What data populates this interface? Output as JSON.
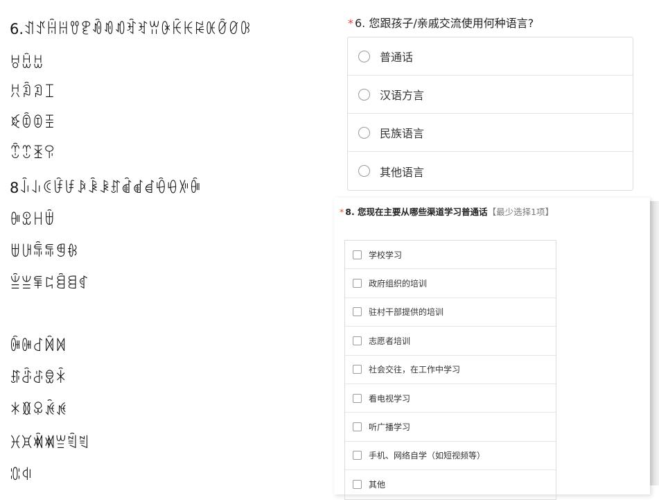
{
  "left_text": [
    "6.ꀊꀋꀌꀍꀎꀏꀐꀑꀒꀓꀔꀕꀖꀗꀘꀙꀚꀛꀜꀝ",
    "ꀞꀟꀠ",
    "ꀡꀢꀣꀤ",
    "ꀥꀦꀧꀨ",
    "ꀩꀪꀫꀬ",
    "8ꀭꀮꀯꀰꀱꀲꀳꀴꀵꀶꀷꀸꀹꀺꀻꀼ",
    "ꀽꀾꀿꁀ",
    "ꁁꁂꁃꁄꁅꁆ",
    "ꁇꁈꁉꁊꁋꁌꁍ",
    "ꁎꁏꁐꁑꁒ",
    "ꁓꁔꁕꁖꁗ",
    "ꁘꁙꁚꁛꁜ",
    "ꁝꁞꁟꁠꁡꁢꁣ",
    "ꁤꁥ"
  ],
  "q6": {
    "required_mark": "*",
    "title": "6. 您跟孩子/亲戚交流使用何种语言?",
    "options": [
      "普通话",
      "汉语方言",
      "民族语言",
      "其他语言"
    ]
  },
  "q8": {
    "required_mark": "*",
    "title": "8. 您现在主要从哪些渠道学习普通话",
    "hint": "【最少选择1项】",
    "options": [
      "学校学习",
      "政府组织的培训",
      "驻村干部提供的培训",
      "志愿者培训",
      "社会交往，在工作中学习",
      "看电视学习",
      "听广播学习",
      "手机、网络自学（如短视频等）",
      "其他"
    ]
  },
  "colors": {
    "required": "#e0463d",
    "border": "#dcdcdc"
  }
}
